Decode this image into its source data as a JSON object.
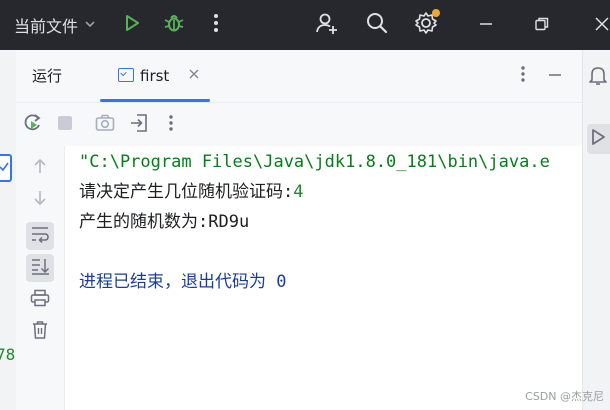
{
  "titlebar": {
    "current_file_label": "当前文件",
    "accent_run": "#57b25a",
    "accent_badge": "#f0a732"
  },
  "left_strip": {
    "partial_number": "78"
  },
  "run_panel": {
    "tab_run_label": "运行",
    "tab_first_label": "first",
    "console": {
      "command_line": "\"C:\\Program Files\\Java\\jdk1.8.0_181\\bin\\java.e",
      "prompt_text": "请决定产生几位随机验证码:",
      "prompt_input": "4",
      "result_text": "产生的随机数为:RD9u",
      "exit_text": "进程已结束，退出代码为 0"
    }
  },
  "watermark": "CSDN @杰克尼",
  "icons": [
    "chevron-down-icon",
    "run-icon",
    "debug-icon",
    "more-vertical-icon",
    "add-user-icon",
    "search-icon",
    "settings-icon",
    "minimize-icon",
    "restore-icon",
    "close-icon",
    "rerun-icon",
    "stop-icon",
    "screenshot-icon",
    "import-icon",
    "arrow-up-icon",
    "arrow-down-icon",
    "soft-wrap-icon",
    "scroll-to-end-icon",
    "print-icon",
    "trash-icon",
    "notifications-icon",
    "run-panel-icon"
  ]
}
